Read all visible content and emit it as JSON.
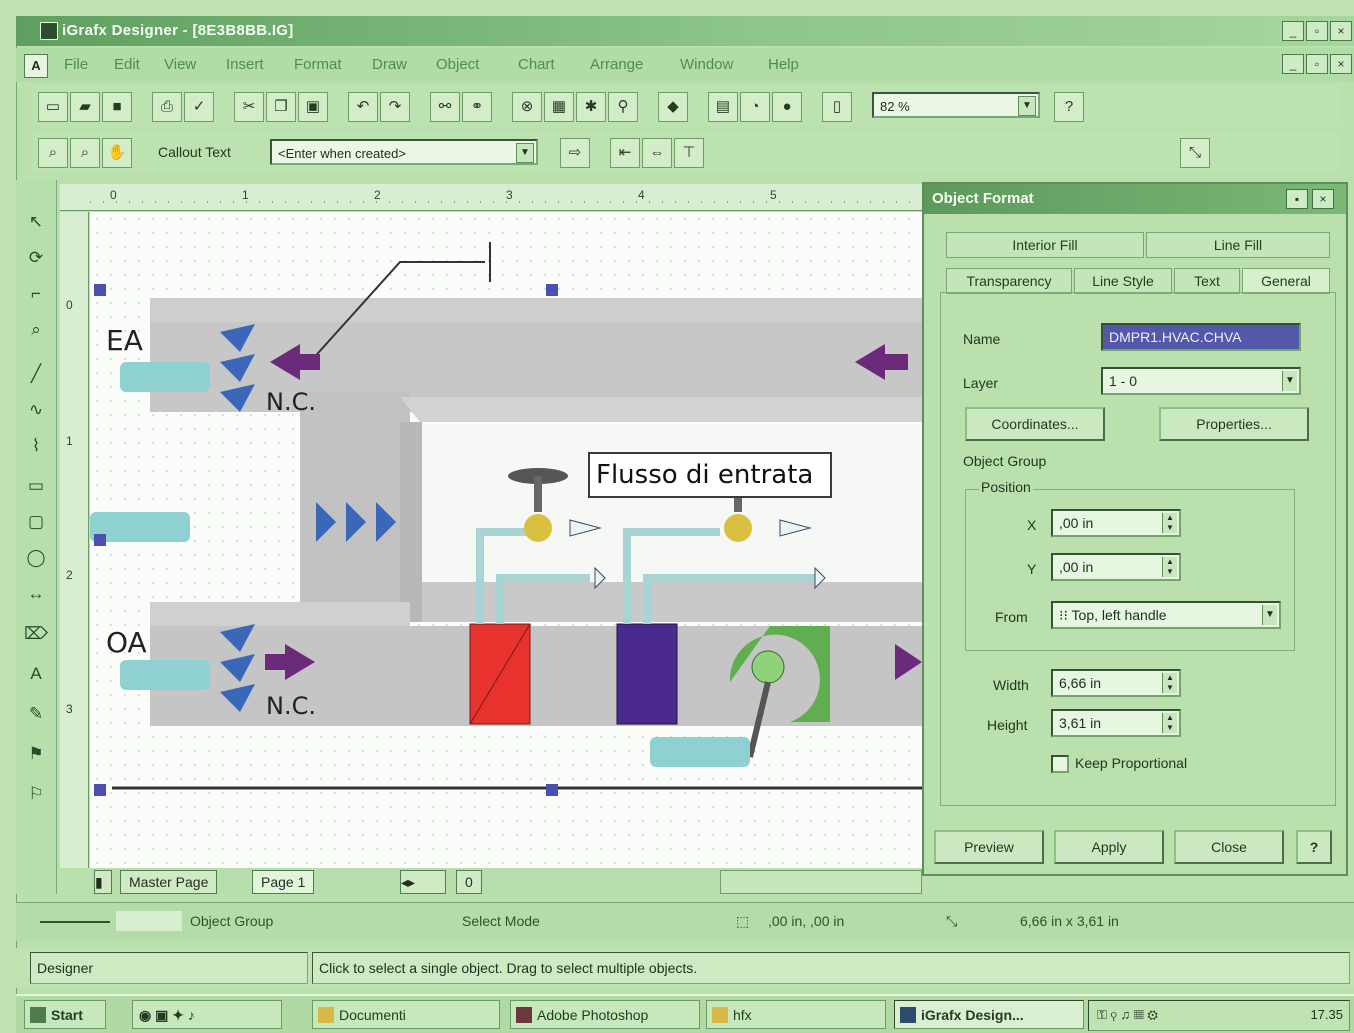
{
  "window": {
    "title": "iGrafx Designer - [8E3B8BB.IG]",
    "min_label": "_",
    "max_label": "▫",
    "close_label": "×"
  },
  "menu": [
    "File",
    "Edit",
    "View",
    "Insert",
    "Format",
    "Draw",
    "Object",
    "Chart",
    "Arrange",
    "Window",
    "Help"
  ],
  "toolbar": {
    "zoom_value": "82 %",
    "callout_label": "Callout Text",
    "callout_value": "<Enter when created>"
  },
  "ruler": {
    "h_ticks": [
      "0",
      "1",
      "2",
      "3",
      "4",
      "5"
    ],
    "v_ticks": [
      "0",
      "1",
      "2",
      "3"
    ]
  },
  "diagram": {
    "callout": "Flusso di entrata",
    "labels": {
      "ea": "EA",
      "nc_top": "N.C.",
      "oa": "OA",
      "nc_bottom": "N.C."
    }
  },
  "page_tabs": {
    "master": "Master Page",
    "page1": "Page 1",
    "counter": "0"
  },
  "dialog": {
    "title": "Object Format",
    "tabs_row1": [
      "Interior Fill",
      "Line Fill"
    ],
    "tabs_row2": [
      "Transparency",
      "Line Style",
      "Text",
      "General"
    ],
    "name_label": "Name",
    "name_value": "DMPR1.HVAC.CHVA",
    "layer_label": "Layer",
    "layer_value": "1 - 0",
    "coordinates_button": "Coordinates...",
    "properties_button": "Properties...",
    "group_label": "Object Group",
    "position_label": "Position",
    "x_label": "X",
    "x_value": ",00 in",
    "y_label": "Y",
    "y_value": ",00 in",
    "from_label": "From",
    "from_value": "Top, left handle",
    "width_label": "Width",
    "width_value": "6,66 in",
    "height_label": "Height",
    "height_value": "3,61 in",
    "keep_proportional": "Keep Proportional",
    "preview_button": "Preview",
    "apply_button": "Apply",
    "close_button": "Close",
    "help_button": "?"
  },
  "status": {
    "object": "Object Group",
    "mode": "Select Mode",
    "position": ",00 in, ,00 in",
    "size": "6,66 in x 3,61 in"
  },
  "hint": {
    "left": "Designer",
    "main": "Click to select a single object. Drag to select multiple objects."
  },
  "taskbar": {
    "start": "Start",
    "items": [
      "Documenti",
      "Adobe Photoshop",
      "hfx",
      "iGrafx Design..."
    ],
    "clock": "17.35"
  },
  "colors": {
    "accent": "#5d995c",
    "red_coil": "#e8322e",
    "blue_coil": "#4a2a8c",
    "fan": "#5fae4f",
    "arrow": "#6b2a7a"
  }
}
